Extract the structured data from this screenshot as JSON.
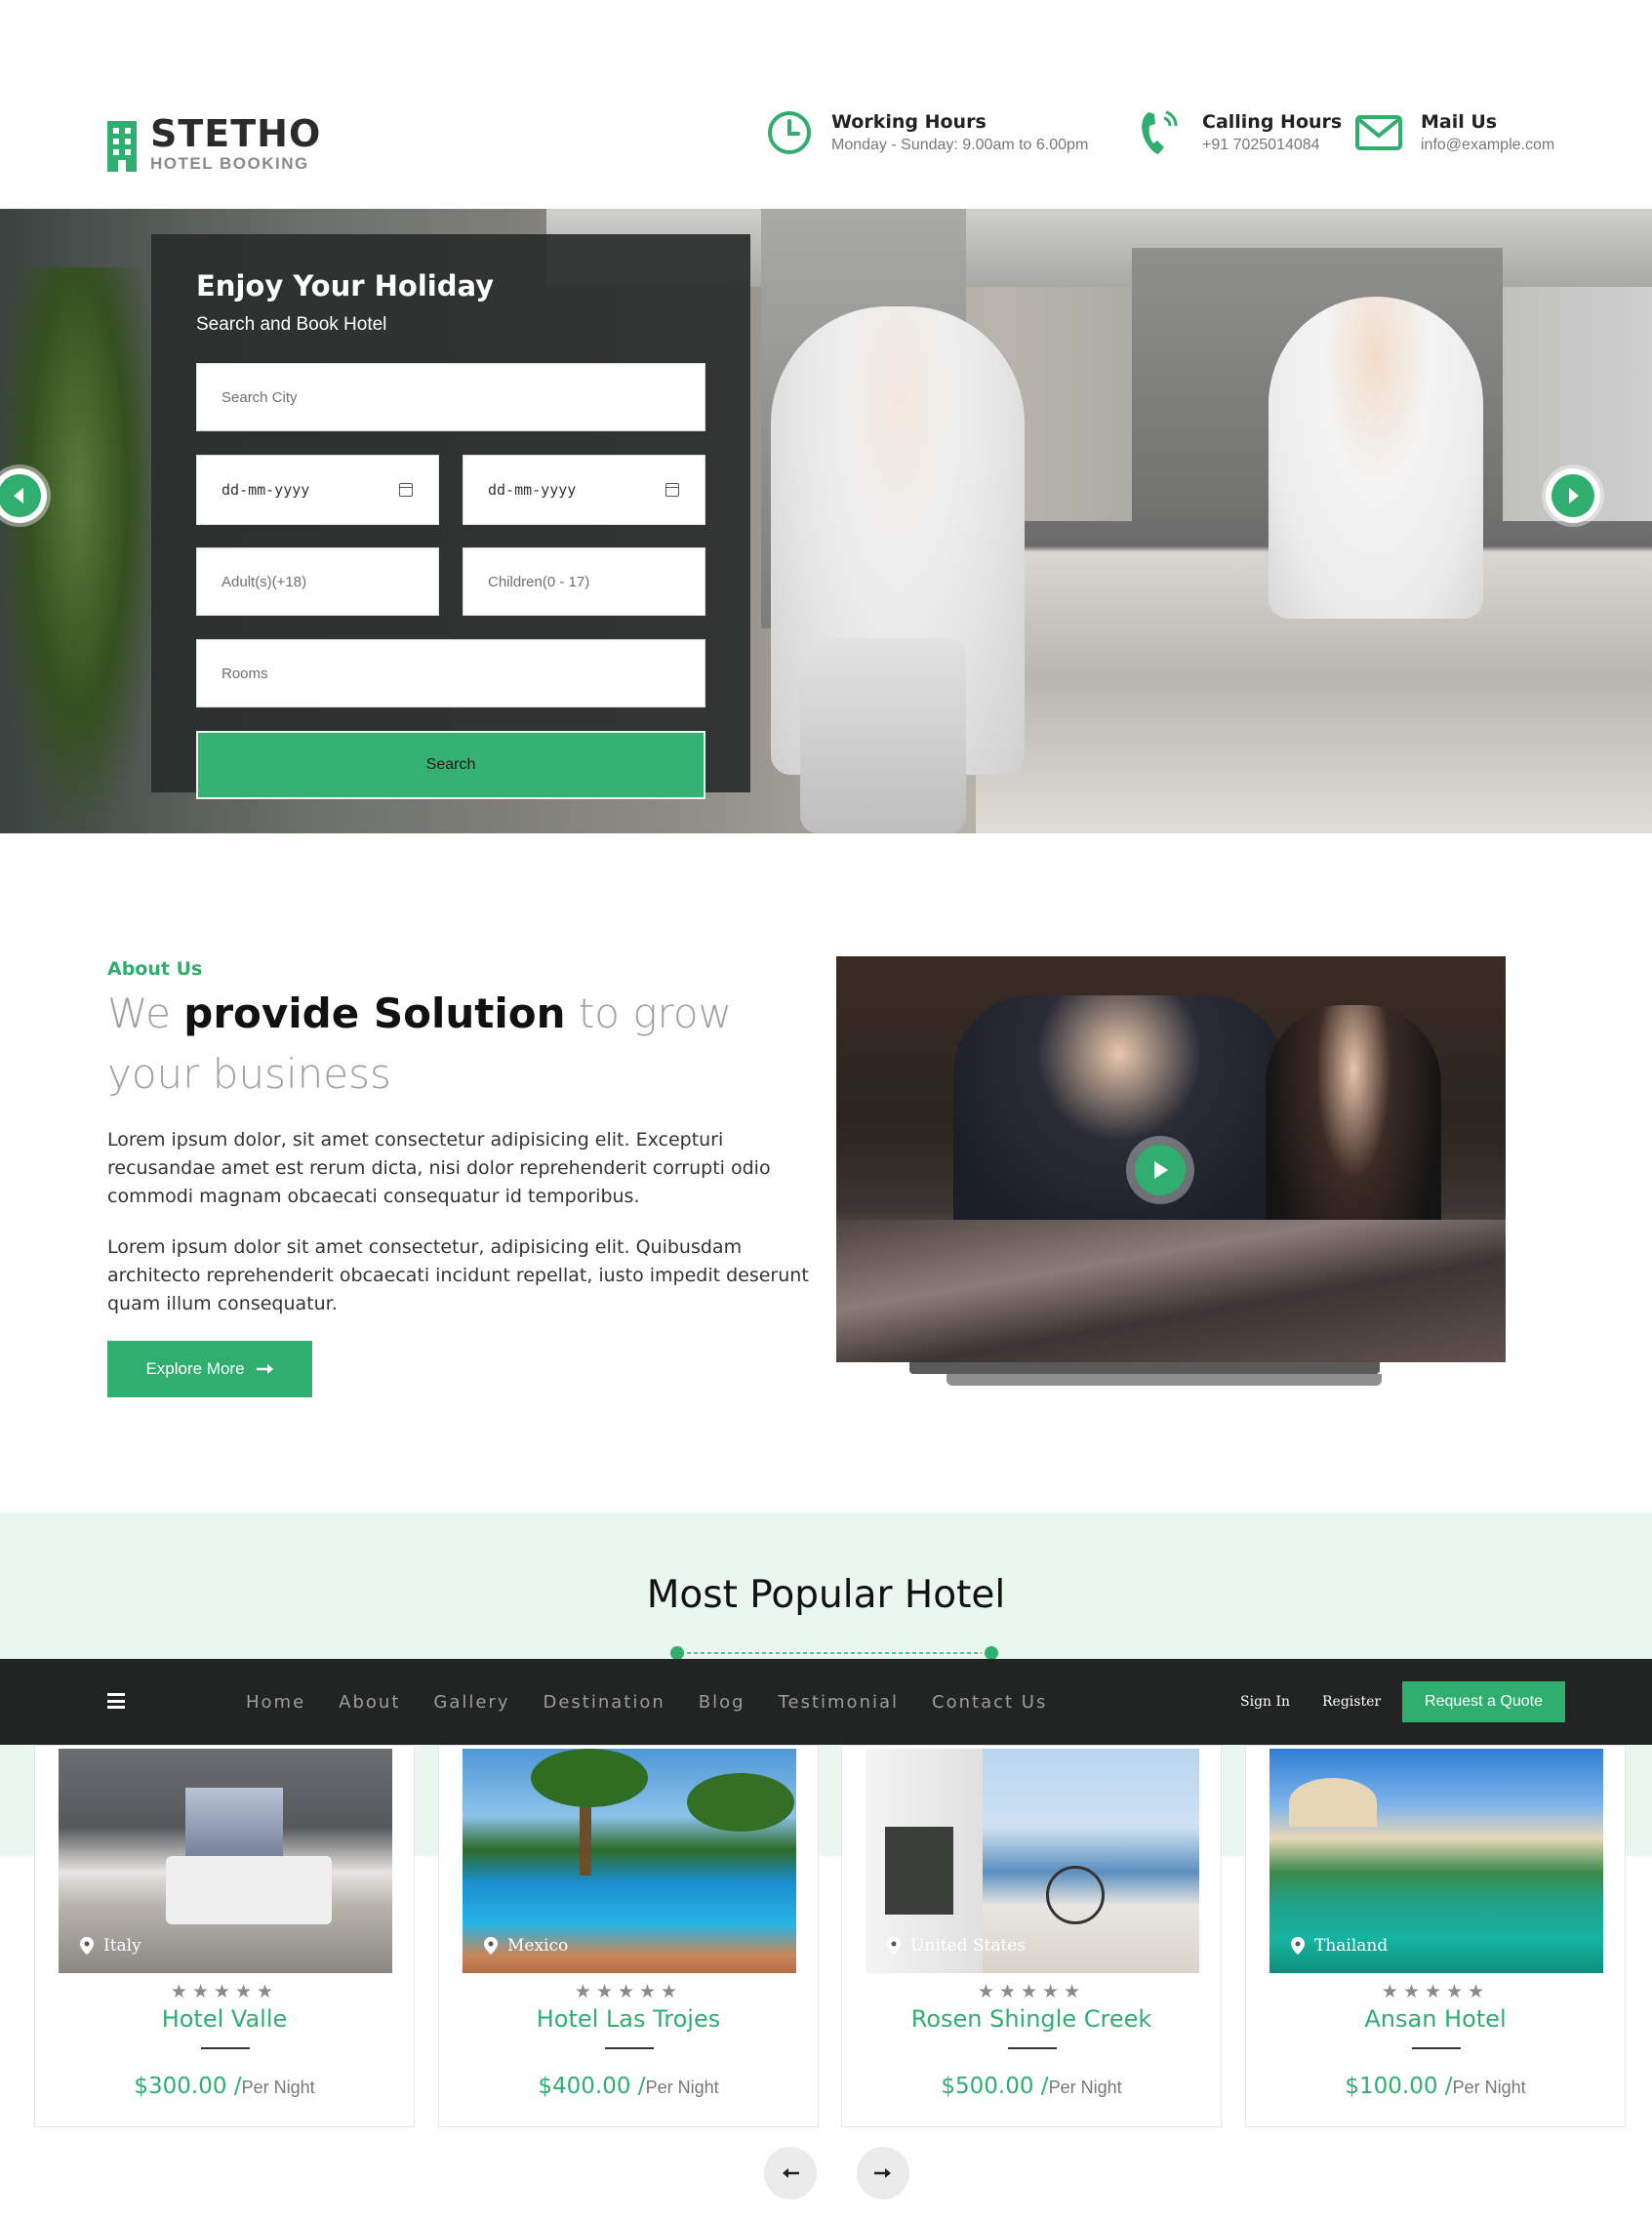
{
  "brand": {
    "name": "STETHO",
    "tagline": "HOTEL BOOKING",
    "accent": "#2fae70"
  },
  "header": {
    "working": {
      "title": "Working Hours",
      "value": "Monday - Sunday: 9.00am to 6.00pm",
      "icon": "clock-icon"
    },
    "calling": {
      "title": "Calling Hours",
      "value": "+91 7025014084",
      "icon": "phone-icon"
    },
    "mail": {
      "title": "Mail Us",
      "value": "info@example.com",
      "icon": "envelope-icon"
    }
  },
  "booking": {
    "title": "Enjoy Your Holiday",
    "subtitle": "Search and Book Hotel",
    "city_placeholder": "Search City",
    "checkin_value": "dd-mm-yyyy",
    "checkout_value": "dd-mm-yyyy",
    "adults_placeholder": "Adult(s)(+18)",
    "children_placeholder": "Children(0 - 17)",
    "rooms_placeholder": "Rooms",
    "search_label": "Search"
  },
  "about": {
    "label": "About Us",
    "heading_pre": "We ",
    "heading_bold": "provide Solution",
    "heading_post": " to grow your business",
    "para1": "Lorem ipsum dolor, sit amet consectetur adipisicing elit. Excepturi recusandae amet est rerum dicta, nisi dolor reprehenderit corrupti odio commodi magnam obcaecati consequatur id temporibus.",
    "para2": "Lorem ipsum dolor sit amet consectetur, adipisicing elit. Quibusdam architecto reprehenderit obcaecati incidunt repellat, iusto impedit deserunt quam illum consequatur.",
    "explore_label": "Explore More"
  },
  "popular": {
    "title": "Most Popular Hotel"
  },
  "nav": {
    "links": [
      "Home",
      "About",
      "Gallery",
      "Destination",
      "Blog",
      "Testimonial",
      "Contact Us"
    ],
    "signin": "Sign In",
    "register": "Register",
    "quote": "Request a Quote"
  },
  "hotels": [
    {
      "location": "Italy",
      "name": "Hotel Valle",
      "price": "$300.00",
      "unit": "Per Night",
      "stars": "★★★★★"
    },
    {
      "location": "Mexico",
      "name": "Hotel Las Trojes",
      "price": "$400.00",
      "unit": "Per Night",
      "stars": "★★★★★"
    },
    {
      "location": "United States",
      "name": "Rosen Shingle Creek",
      "price": "$500.00",
      "unit": "Per Night",
      "stars": "★★★★★"
    },
    {
      "location": "Thailand",
      "name": "Ansan Hotel",
      "price": "$100.00",
      "unit": "Per Night",
      "stars": "★★★★★"
    }
  ]
}
